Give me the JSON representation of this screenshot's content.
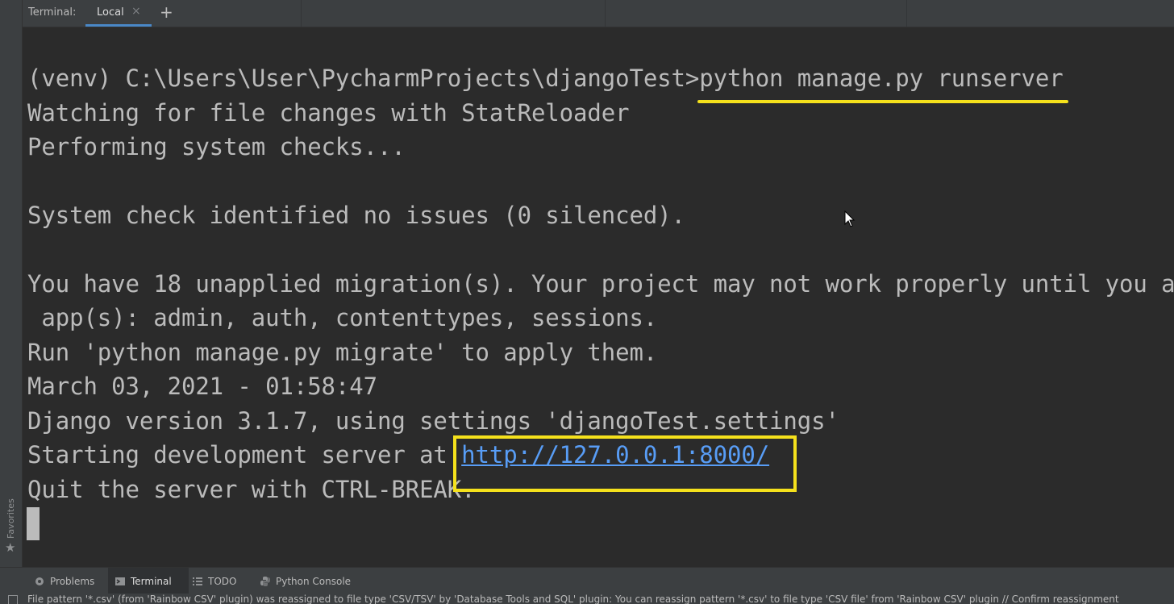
{
  "tabs": {
    "prefix": "Terminal:",
    "active_tab": "Local",
    "close_glyph": "×",
    "add_glyph": "+"
  },
  "favorites": {
    "label": "Favorites",
    "icon": "star-icon"
  },
  "terminal": {
    "lines": [
      "(venv) C:\\Users\\User\\PycharmProjects\\djangoTest>python manage.py runserver",
      "Watching for file changes with StatReloader",
      "Performing system checks...",
      "",
      "System check identified no issues (0 silenced).",
      "",
      "You have 18 unapplied migration(s). Your project may not work properly until you a",
      " app(s): admin, auth, contenttypes, sessions.",
      "Run 'python manage.py migrate' to apply them.",
      "March 03, 2021 - 01:58:47",
      "Django version 3.1.7, using settings 'djangoTest.settings'",
      "Quit the server with CTRL-BREAK."
    ],
    "server_line_prefix": "Starting development server at ",
    "server_url": "http://127.0.0.1:8000/",
    "annotation_color": "#f5e11c",
    "link_color": "#589df6"
  },
  "tool_windows": [
    {
      "label": "Problems",
      "icon": "problems-icon"
    },
    {
      "label": "Terminal",
      "icon": "terminal-icon",
      "active": true
    },
    {
      "label": "TODO",
      "icon": "todo-list-icon"
    },
    {
      "label": "Python Console",
      "icon": "python-icon"
    }
  ],
  "status": {
    "message": "File pattern '*.csv' (from 'Rainbow CSV' plugin) was reassigned to file type 'CSV/TSV' by 'Database Tools and SQL' plugin: You can reassign pattern '*.csv' to file type 'CSV file' from 'Rainbow CSV' plugin // Confirm reassignment"
  },
  "colors": {
    "background": "#2b2b2b",
    "panel": "#3c3f41",
    "accent": "#4a88c7",
    "text": "#bbbbbb"
  }
}
